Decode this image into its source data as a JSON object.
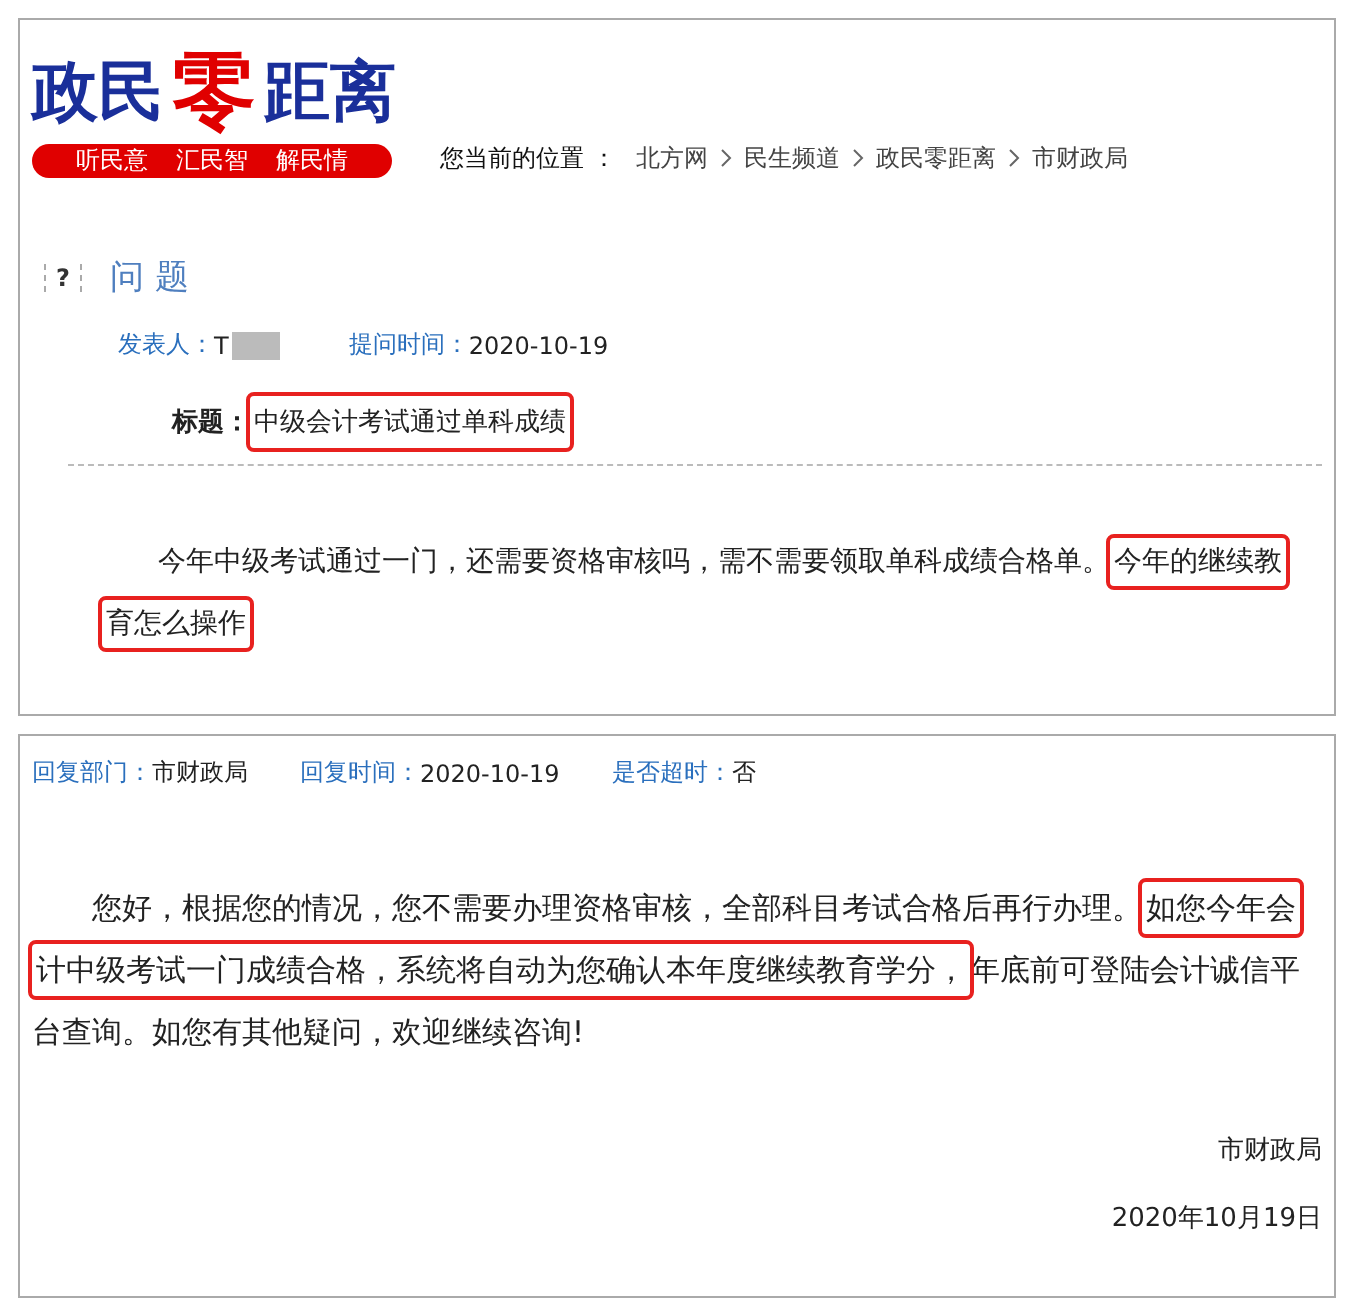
{
  "logo": {
    "parts": [
      {
        "text": "政民",
        "kind": "plain"
      },
      {
        "text": "零",
        "kind": "accent"
      },
      {
        "text": "距离",
        "kind": "plain"
      }
    ],
    "slogans": [
      "听民意",
      "汇民智",
      "解民情"
    ]
  },
  "breadcrumb": {
    "label": "您当前的位置 ：",
    "items": [
      "北方网",
      "民生频道",
      "政民零距离",
      "市财政局"
    ]
  },
  "question": {
    "icon": "?",
    "heading": "问 题",
    "author_label": "发表人：",
    "author": "T",
    "time_label": "提问时间：",
    "time": "2020-10-19",
    "title_label": "标题：",
    "title": "中级会计考试通过单科成绩",
    "title_highlighted": true,
    "body": [
      {
        "text": "今年中级考试通过一门，还需要资格审核吗，需不需要领取单科成绩合格单。",
        "highlighted": false
      },
      {
        "text": "今年的继续教育怎么操作",
        "highlighted": true
      }
    ]
  },
  "reply": {
    "meta": [
      {
        "label": "回复部门：",
        "value": "市财政局"
      },
      {
        "label": "回复时间：",
        "value": "2020-10-19"
      },
      {
        "label": "是否超时：",
        "value": "否"
      }
    ],
    "body": [
      {
        "text": "您好，根据您的情况，您不需要办理资格审核，全部科目考试合格后再行办理。",
        "highlighted": false
      },
      {
        "text": "如您今年会计中级考试一门成绩合格，系统将自动为您确认本年度继续教育学分，",
        "highlighted": true
      },
      {
        "text": "年底前可登陆会计诚信平台查询。如您有其他疑问，欢迎继续咨询!",
        "highlighted": false
      }
    ],
    "signature": "市财政局",
    "date": "2020年10月19日"
  }
}
